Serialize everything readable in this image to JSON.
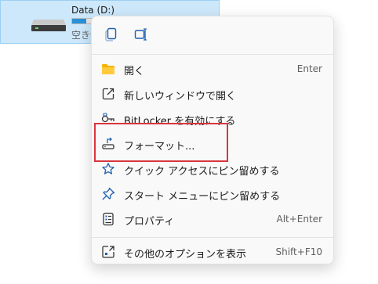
{
  "drive": {
    "name": "Data (D:)",
    "free_text": "空き領",
    "usage_fraction": 0.12
  },
  "quick_actions": [
    {
      "icon": "copy-icon"
    },
    {
      "icon": "rename-icon"
    }
  ],
  "menu_items": [
    {
      "label": "開く",
      "shortcut": "Enter",
      "icon": "folder-icon"
    },
    {
      "label": "新しいウィンドウで開く",
      "shortcut": "",
      "icon": "open-new-window-icon"
    },
    {
      "label": "BitLocker を有効にする",
      "shortcut": "",
      "icon": "key-icon"
    },
    {
      "label": "フォーマット...",
      "shortcut": "",
      "icon": "format-drive-icon"
    },
    {
      "label": "クイック アクセスにピン留めする",
      "shortcut": "",
      "icon": "star-icon"
    },
    {
      "label": "スタート メニューにピン留めする",
      "shortcut": "",
      "icon": "pin-icon"
    },
    {
      "label": "プロパティ",
      "shortcut": "Alt+Enter",
      "icon": "properties-icon"
    },
    {
      "label": "その他のオプションを表示",
      "shortcut": "Shift+F10",
      "icon": "more-options-icon"
    }
  ],
  "colors": {
    "accent": "#2a90d8",
    "highlight_box": "#d9363e",
    "selection_bg": "#cde8fb"
  }
}
